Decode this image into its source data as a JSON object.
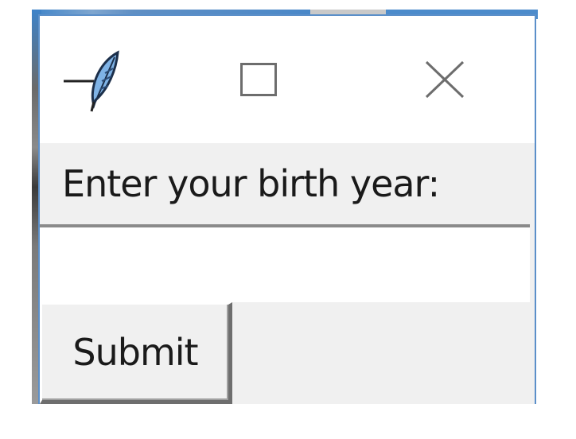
{
  "window": {
    "app_icon": "feather-icon",
    "maximize_icon": "maximize-icon",
    "close_icon": "close-icon"
  },
  "form": {
    "label": "Enter your birth year:",
    "entry_value": "",
    "submit_label": "Submit"
  },
  "colors": {
    "window_border": "#5b8fc9",
    "background": "#f0f0f0",
    "titlebar": "#ffffff"
  }
}
